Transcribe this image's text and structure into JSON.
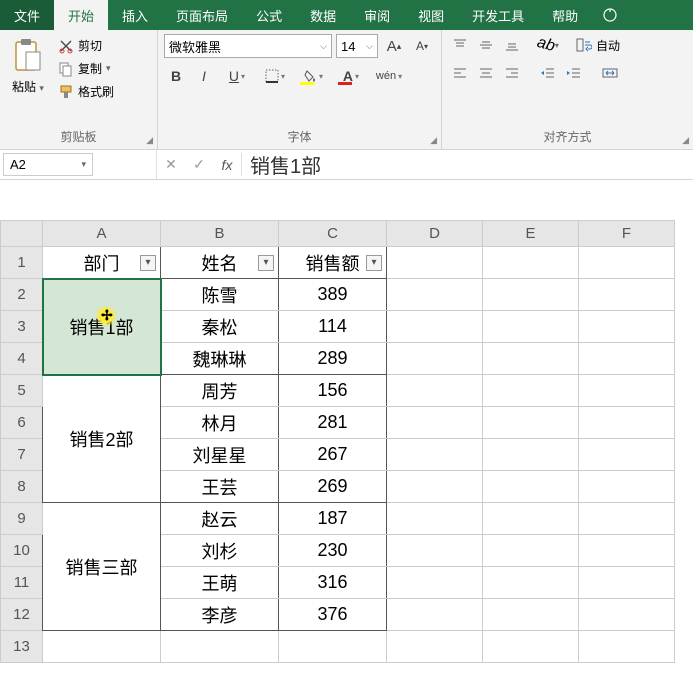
{
  "tabs": {
    "file": "文件",
    "home": "开始",
    "insert": "插入",
    "layout": "页面布局",
    "formula": "公式",
    "data": "数据",
    "review": "审阅",
    "view": "视图",
    "dev": "开发工具",
    "help": "帮助"
  },
  "ribbon": {
    "clipboard": {
      "label": "剪贴板",
      "paste": "粘贴",
      "cut": "剪切",
      "copy": "复制",
      "format_painter": "格式刷"
    },
    "font": {
      "label": "字体",
      "name": "微软雅黑",
      "size": "14",
      "wen": "wén"
    },
    "align": {
      "label": "对齐方式",
      "wrap": "自动"
    }
  },
  "formula_bar": {
    "name_box": "A2",
    "value": "销售1部"
  },
  "grid": {
    "col_headers": [
      "A",
      "B",
      "C",
      "D",
      "E",
      "F"
    ],
    "row_headers": [
      "1",
      "2",
      "3",
      "4",
      "5",
      "6",
      "7",
      "8",
      "9",
      "10",
      "11",
      "12",
      "13"
    ],
    "headers": {
      "dept": "部门",
      "name": "姓名",
      "sales": "销售额"
    },
    "groups": [
      {
        "dept": "销售1部",
        "rows": [
          {
            "name": "陈雪",
            "sales": "389"
          },
          {
            "name": "秦松",
            "sales": "114"
          },
          {
            "name": "魏琳琳",
            "sales": "289"
          }
        ]
      },
      {
        "dept": "销售2部",
        "rows": [
          {
            "name": "周芳",
            "sales": "156"
          },
          {
            "name": "林月",
            "sales": "281"
          },
          {
            "name": "刘星星",
            "sales": "267"
          },
          {
            "name": "王芸",
            "sales": "269"
          }
        ]
      },
      {
        "dept": "销售三部",
        "rows": [
          {
            "name": "赵云",
            "sales": "187"
          },
          {
            "name": "刘杉",
            "sales": "230"
          },
          {
            "name": "王萌",
            "sales": "316"
          },
          {
            "name": "李彦",
            "sales": "376"
          }
        ]
      }
    ]
  }
}
